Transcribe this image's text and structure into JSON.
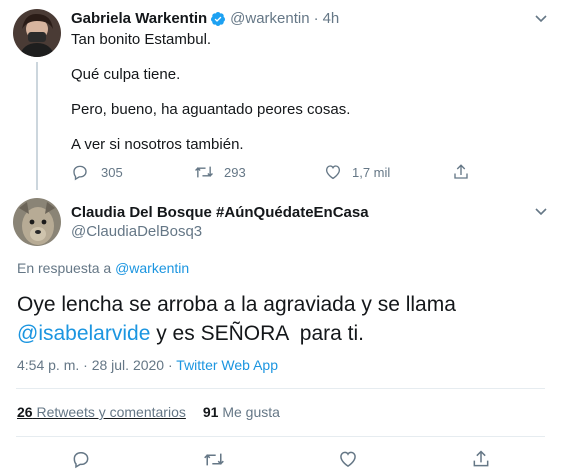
{
  "first_tweet": {
    "author_name": "Gabriela Warkentin",
    "handle": "@warkentin",
    "separator": "·",
    "time": "4h",
    "lines": [
      "Tan bonito Estambul.",
      "Qué culpa tiene.",
      "Pero, bueno, ha aguantado peores cosas.",
      "A ver si nosotros también."
    ],
    "actions": {
      "replies": "305",
      "retweets": "293",
      "likes": "1,7 mil"
    }
  },
  "second_tweet": {
    "author_name": "Claudia Del Bosque #AúnQuédateEnCasa",
    "handle": "@ClaudiaDelBosq3",
    "reply_prefix": "En respuesta a",
    "reply_to": "@warkentin",
    "text_part1": "Oye lencha se arroba a la agraviada y se llama",
    "mention": "@isabelarvide",
    "text_part2": " y es SEÑORA  para ti.",
    "timestamp": "4:54 p. m. · 28 jul. 2020",
    "timestamp_sep": " · ",
    "source": "Twitter Web App",
    "retweets_count": "26",
    "retweets_label": "Retweets y comentarios",
    "likes_count": "91",
    "likes_label": "Me gusta"
  },
  "icons": {
    "verified": "verified-badge-icon",
    "caret": "chevron-down-icon",
    "reply": "reply-icon",
    "retweet": "retweet-icon",
    "like": "heart-icon",
    "share": "share-icon"
  },
  "colors": {
    "accent": "#1b95e0",
    "muted": "#657786",
    "text": "#14171a"
  }
}
